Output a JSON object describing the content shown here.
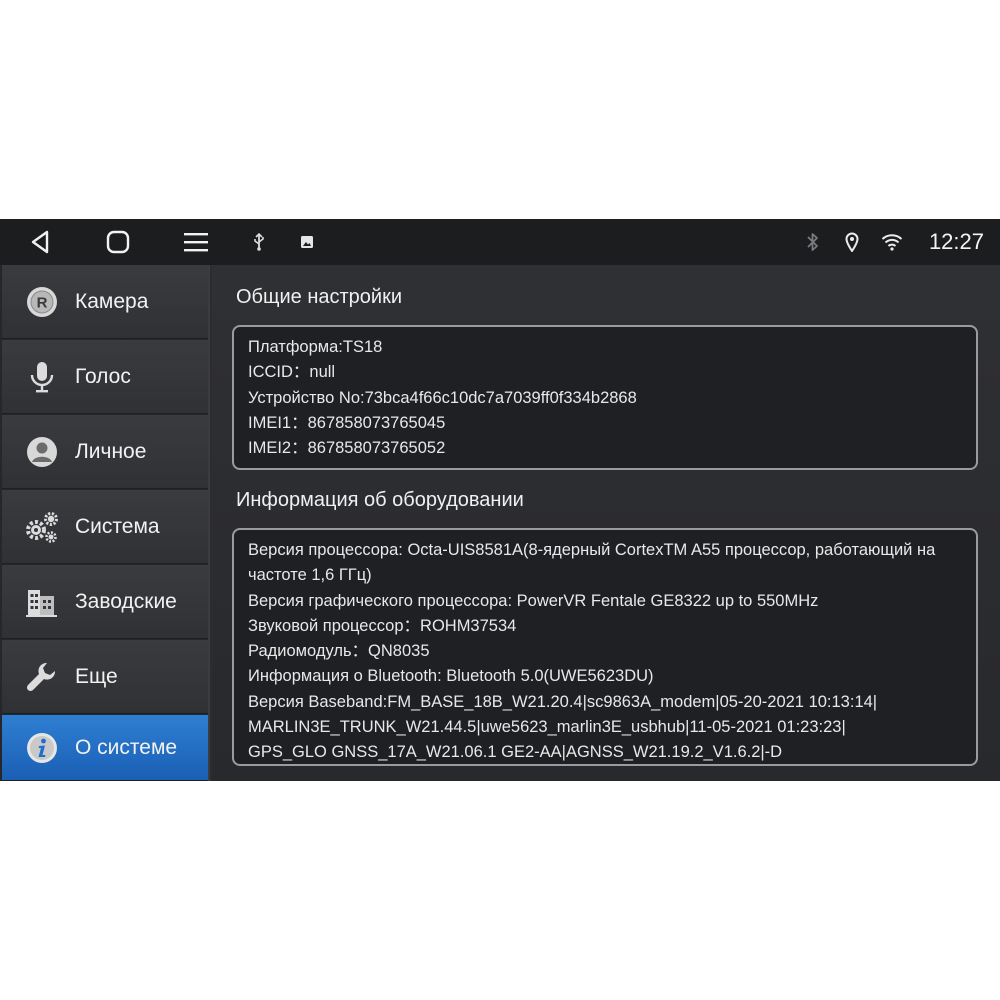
{
  "status_bar": {
    "time": "12:27",
    "icons": [
      "back-icon",
      "home-icon",
      "menu-icon",
      "usb-icon",
      "image-icon",
      "bluetooth-icon",
      "location-icon",
      "wifi-icon"
    ]
  },
  "sidebar": {
    "items": [
      {
        "label": "Камера",
        "icon": "camera-r-icon"
      },
      {
        "label": "Голос",
        "icon": "microphone-icon"
      },
      {
        "label": "Личное",
        "icon": "person-icon"
      },
      {
        "label": "Система",
        "icon": "gears-icon"
      },
      {
        "label": "Заводские",
        "icon": "factory-icon"
      },
      {
        "label": "Еще",
        "icon": "wrench-icon"
      },
      {
        "label": "О системе",
        "icon": "info-icon",
        "active": true
      }
    ]
  },
  "general": {
    "title": "Общие настройки",
    "rows": [
      "Платформа:TS18",
      "ICCID：null",
      "Устройство No:73bca4f66c10dc7a7039ff0f334b2868",
      "IMEI1：867858073765045",
      "IMEI2：867858073765052"
    ]
  },
  "hardware": {
    "title": "Информация об оборудовании",
    "rows": [
      "Версия процессора: Octa-UIS8581A(8-ядерный CortexTM A55 процессор, работающий на частоте 1,6 ГГц)",
      "Версия графического процессора: PowerVR Fentale GE8322 up to 550MHz",
      "Звуковой процессор：ROHM37534",
      "Радиомодуль：QN8035",
      "Информация о Bluetooth: Bluetooth 5.0(UWE5623DU)",
      "Версия Baseband:FM_BASE_18B_W21.20.4|sc9863A_modem|05-20-2021 10:13:14|",
      "MARLIN3E_TRUNK_W21.44.5|uwe5623_marlin3E_usbhub|11-05-2021 01:23:23|",
      "GPS_GLO GNSS_17A_W21.06.1 GE2-AA|AGNSS_W21.19.2_V1.6.2|-D"
    ]
  },
  "colors": {
    "accent": "#1f6fc9",
    "background": "#2b2c2f",
    "panel_border": "#9a9ba0"
  }
}
